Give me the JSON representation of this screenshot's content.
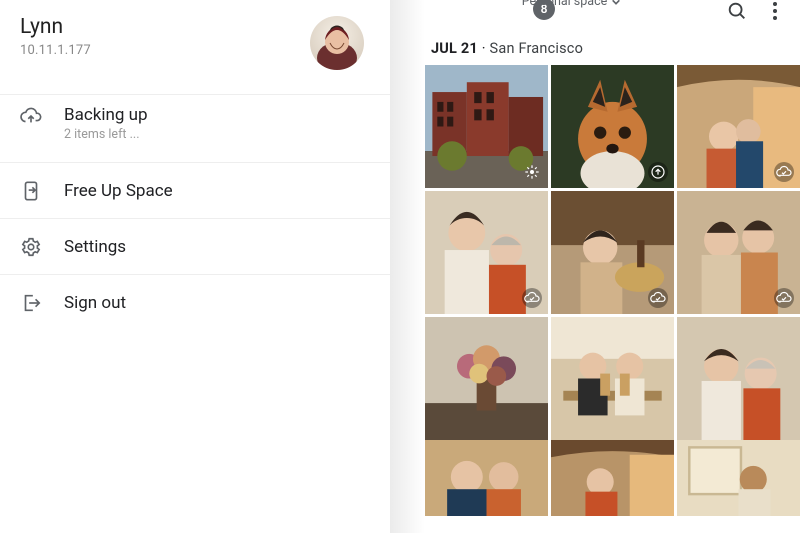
{
  "profile": {
    "name": "Lynn",
    "ip": "10.11.1.177"
  },
  "menu": {
    "backup": {
      "label": "Backing up",
      "sub": "2 items left ..."
    },
    "freespace": {
      "label": "Free Up Space"
    },
    "settings": {
      "label": "Settings"
    },
    "signout": {
      "label": "Sign out"
    }
  },
  "topbar": {
    "badge": "8",
    "space_label": "Personal space"
  },
  "dateline": {
    "date": "JUL 21",
    "sep": " · ",
    "location": "San Francisco"
  },
  "tiles": {
    "t0_overlay": "sparkle-icon",
    "t1_overlay": "upload-circle-icon",
    "t2_overlay": "cloud-done-icon",
    "t3_overlay": "cloud-done-icon",
    "t4_overlay": "cloud-done-icon",
    "t5_overlay": "cloud-done-icon"
  }
}
